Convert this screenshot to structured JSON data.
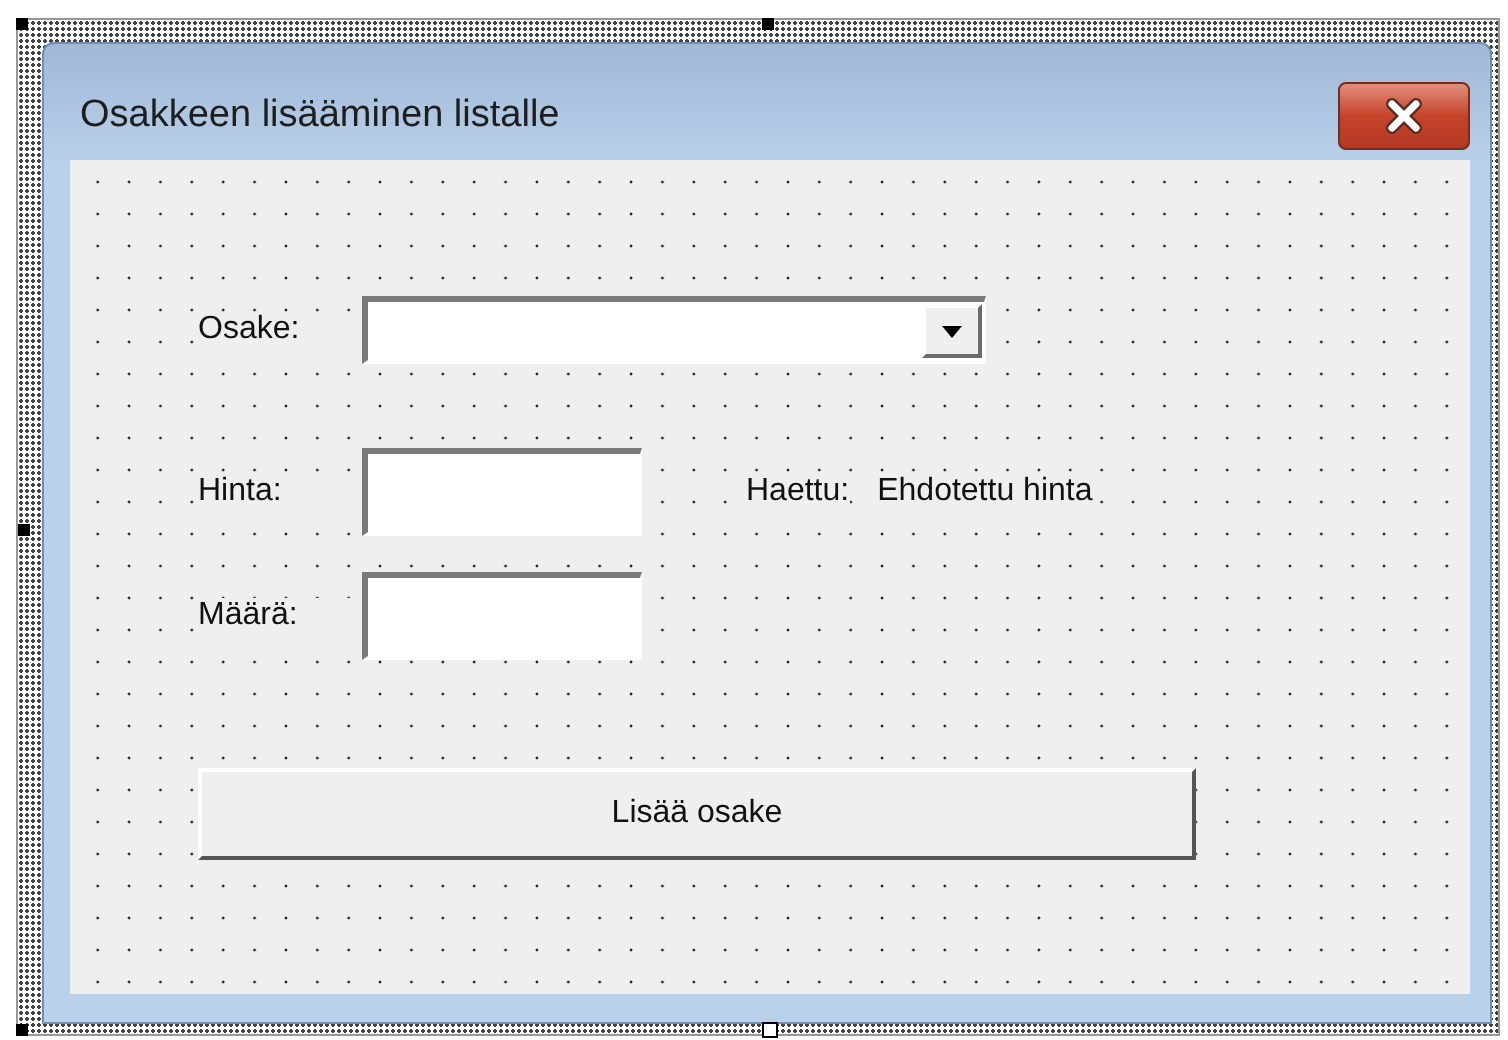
{
  "window": {
    "title": "Osakkeen lisääminen listalle"
  },
  "fields": [
    {
      "label": "Osake:",
      "kind": "combo"
    },
    {
      "label": "Hinta:",
      "kind": "text",
      "note": "Haettu:",
      "note_value": "Ehdotettu hinta"
    },
    {
      "label": "Määrä:",
      "kind": "text"
    }
  ],
  "button": {
    "label": "Lisää osake"
  }
}
